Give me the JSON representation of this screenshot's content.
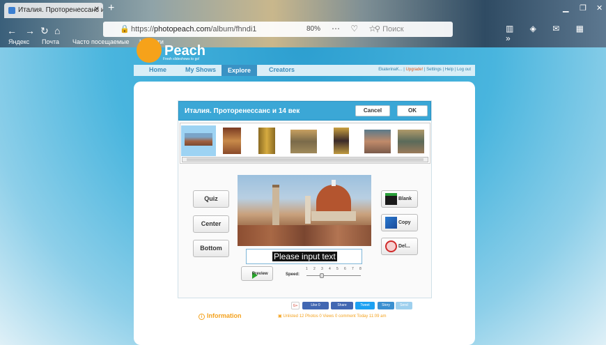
{
  "browser": {
    "tab_title": "Италия. Проторенессанс и 14 век",
    "url_prefix": "https://",
    "url_domain": "photopeach.com",
    "url_path": "/album/fhndi1",
    "zoom": "80%",
    "search_placeholder": "Поиск",
    "bookmarks": [
      "Яндекс",
      "Почта",
      "Часто посещаемые",
      "Новости"
    ]
  },
  "site": {
    "logo_text": "Peach",
    "tagline": "Fresh slideshows to go!",
    "nav": [
      "Home",
      "My Shows",
      "Explore",
      "Creators"
    ],
    "active_nav": "Explore",
    "user_name": "EkaterinaK...",
    "upgrade_link": "Upgrade!",
    "settings_link": "Settings",
    "help_link": "Help",
    "logout_link": "Log out"
  },
  "editor": {
    "title": "Италия. Проторенессанс и 14 век",
    "cancel_label": "Cancel",
    "ok_label": "OK",
    "left_buttons": [
      "Quiz",
      "Center",
      "Bottom"
    ],
    "right_buttons": [
      "Blank",
      "Copy",
      "Del..."
    ],
    "text_input_value": "Please input text",
    "preview_label": "Preview",
    "speed_label": "Speed:",
    "speed_ticks": [
      "1",
      "2",
      "3",
      "4",
      "5",
      "6",
      "7",
      "8"
    ],
    "speed_value": 3
  },
  "footer": {
    "info_label": "Information",
    "social": [
      "G+",
      "Like 0",
      "Share",
      "Tweet",
      "Story",
      "Send"
    ],
    "meta_visibility": "Unlisted",
    "meta_photos": "12 Photos",
    "meta_views": "0 Views",
    "meta_comments": "0 comment",
    "meta_time": "Today 11:09 am"
  }
}
